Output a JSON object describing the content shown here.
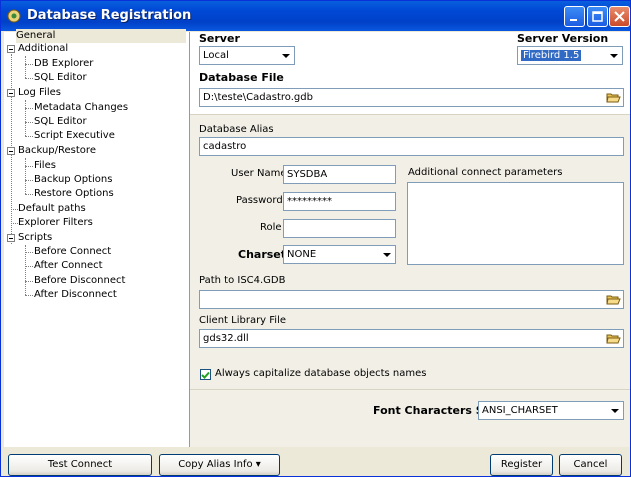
{
  "window": {
    "title": "Database Registration"
  },
  "tree": {
    "items": [
      {
        "label": "General"
      },
      {
        "label": "Additional"
      },
      {
        "label": "DB Explorer"
      },
      {
        "label": "SQL Editor"
      },
      {
        "label": "Log Files"
      },
      {
        "label": "Metadata Changes"
      },
      {
        "label": "SQL Editor"
      },
      {
        "label": "Script Executive"
      },
      {
        "label": "Backup/Restore"
      },
      {
        "label": "Files"
      },
      {
        "label": "Backup Options"
      },
      {
        "label": "Restore Options"
      },
      {
        "label": "Default paths"
      },
      {
        "label": "Explorer Filters"
      },
      {
        "label": "Scripts"
      },
      {
        "label": "Before Connect"
      },
      {
        "label": "After Connect"
      },
      {
        "label": "Before Disconnect"
      },
      {
        "label": "After Disconnect"
      }
    ]
  },
  "form": {
    "server_label": "Server",
    "server_value": "Local",
    "server_version_label": "Server Version",
    "server_version_value": "Firebird 1.5",
    "db_file_label": "Database File",
    "db_file_value": "D:\\teste\\Cadastro.gdb",
    "alias_label": "Database Alias",
    "alias_value": "cadastro",
    "username_label": "User Name",
    "username_value": "SYSDBA",
    "password_label": "Password",
    "password_value": "*********",
    "role_label": "Role",
    "role_value": "",
    "charset_label": "Charset",
    "charset_value": "NONE",
    "additional_label": "Additional connect parameters",
    "isc4_label": "Path to ISC4.GDB",
    "isc4_value": "",
    "client_lib_label": "Client Library File",
    "client_lib_value": "gds32.dll",
    "capitalize_label": "Always capitalize database objects names",
    "capitalize_checked": true,
    "font_charset_label": "Font Characters Set",
    "font_charset_value": "ANSI_CHARSET"
  },
  "buttons": {
    "test_connect": "Test Connect",
    "copy_alias": "Copy Alias Info",
    "register": "Register",
    "cancel": "Cancel"
  }
}
